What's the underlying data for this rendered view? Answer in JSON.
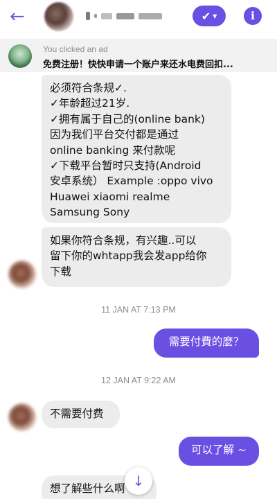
{
  "header": {
    "back_icon": "arrow-left-icon",
    "check_icon": "check-dropdown-icon",
    "info_icon": "info-icon",
    "accent": "#6a4fe3"
  },
  "ad_banner": {
    "label": "You clicked an ad",
    "text": "免费注册！快快申请一个账户来还水电费回扣..."
  },
  "messages": {
    "m1": "必须符合条规✓.\n✓年龄超过21岁.\n✓拥有属于自己的(online bank)\n因为我们平台交付都是通过\nonline banking 来付款呢\n✓下载平台暂时只支持(Android\n安卓系统） Example :oppo vivo\nHuawei xiaomi realme\nSamsung Sony",
    "m2": "如果你符合条规，有兴趣..可以\n留下你的whtapp我会发app给你\n下载",
    "m3": "需要付費的麼？",
    "m4": "不需要付费",
    "m5": "可以了解 ~",
    "m6": "想了解些什么啊"
  },
  "timestamps": {
    "t1": "11 JAN AT 7:13 PM",
    "t2": "12 JAN AT 9:22 AM"
  },
  "scroll": {
    "icon": "arrow-down-icon",
    "glyph": "↓"
  }
}
